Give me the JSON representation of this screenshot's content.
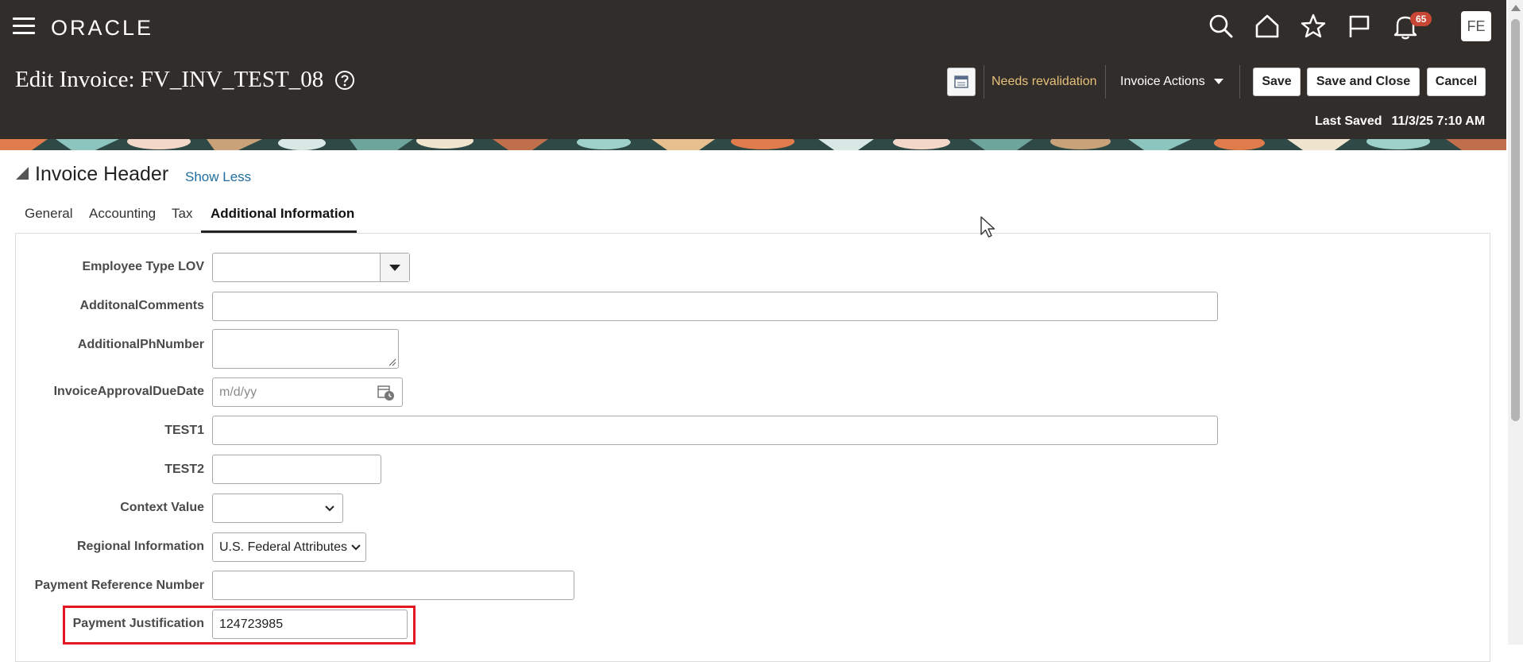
{
  "app": {
    "logo_text": "ORACLE",
    "notification_count": "65",
    "avatar_initials": "FE"
  },
  "header": {
    "title": "Edit Invoice: FV_INV_TEST_08",
    "status": "Needs revalidation",
    "invoice_actions_label": "Invoice Actions",
    "save_label": "Save",
    "save_close_label": "Save and Close",
    "cancel_label": "Cancel",
    "last_saved_label": "Last Saved",
    "last_saved_value": "11/3/25 7:10 AM"
  },
  "section": {
    "title": "Invoice Header",
    "toggle_label": "Show Less"
  },
  "tabs": [
    {
      "label": "General"
    },
    {
      "label": "Accounting"
    },
    {
      "label": "Tax"
    },
    {
      "label": "Additional Information",
      "active": true
    }
  ],
  "fields": {
    "employee_type_lov": {
      "label": "Employee Type LOV",
      "value": ""
    },
    "additional_comments": {
      "label": "AdditonalComments",
      "value": ""
    },
    "additional_ph_number": {
      "label": "AdditionalPhNumber",
      "value": ""
    },
    "invoice_approval_due_date": {
      "label": "InvoiceApprovalDueDate",
      "placeholder": "m/d/yy",
      "value": ""
    },
    "test1": {
      "label": "TEST1",
      "value": ""
    },
    "test2": {
      "label": "TEST2",
      "value": ""
    },
    "context_value": {
      "label": "Context Value",
      "value": ""
    },
    "regional_information": {
      "label": "Regional Information",
      "value": "U.S. Federal Attributes"
    },
    "payment_reference_number": {
      "label": "Payment Reference Number",
      "value": ""
    },
    "payment_justification": {
      "label": "Payment Justification",
      "value": "124723985"
    }
  },
  "colors": {
    "header_bg": "#312d2a",
    "status_text": "#e5c07b",
    "link": "#216d9e",
    "badge": "#c74634",
    "highlight_box": "#e2171f"
  },
  "icons": [
    "hamburger-icon",
    "search-icon",
    "home-icon",
    "star-icon",
    "flag-icon",
    "bell-icon",
    "help-icon",
    "calendar-icon",
    "chevron-down-icon",
    "mouse-cursor-icon"
  ]
}
